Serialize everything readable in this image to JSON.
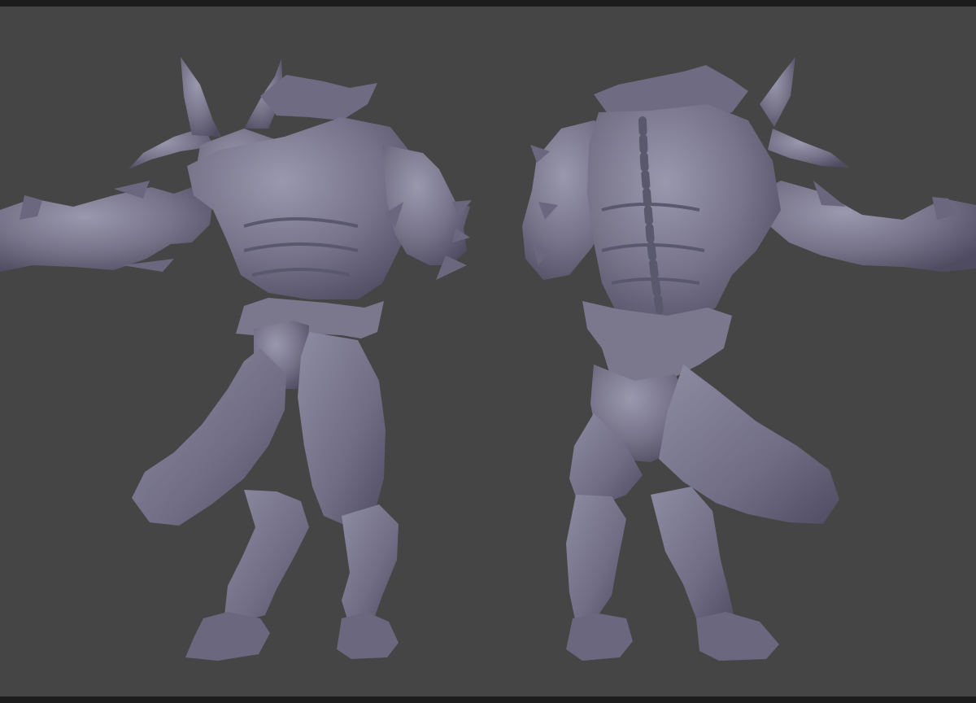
{
  "scene": {
    "background_color": "#454545",
    "letterbox_color": "#1c1c1c",
    "material_color": "#77748a",
    "material_shadow_color": "#4f4c62",
    "material_highlight_color": "#9a98ad",
    "views": [
      {
        "name": "front-view"
      },
      {
        "name": "back-view"
      }
    ]
  }
}
